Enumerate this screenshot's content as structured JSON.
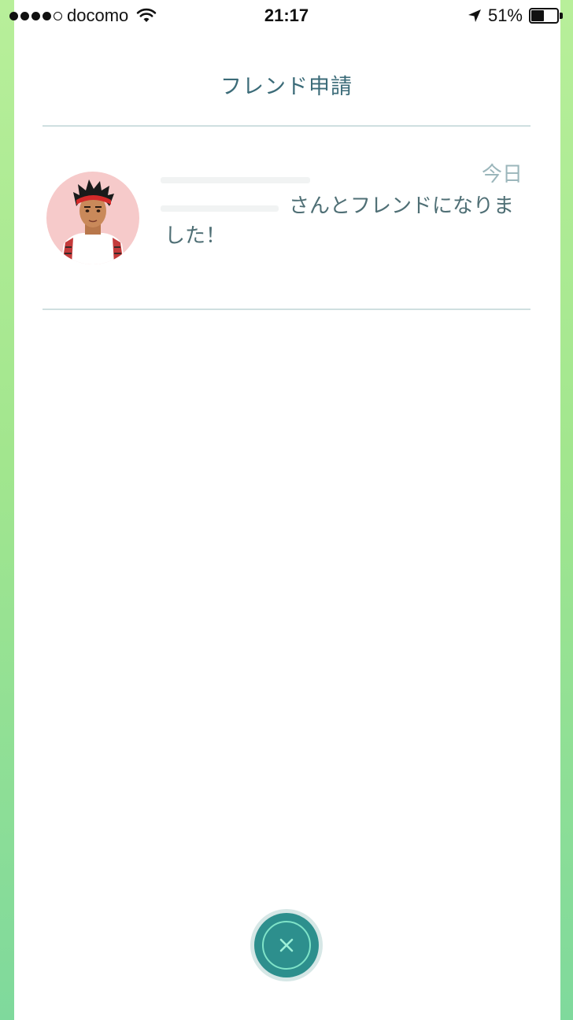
{
  "status_bar": {
    "carrier": "docomo",
    "time": "21:17",
    "battery_percent": "51%",
    "battery_level": 0.51,
    "signal_bars_filled": 4,
    "signal_bars_total": 5
  },
  "header": {
    "title": "フレンド申請"
  },
  "notification": {
    "timestamp": "今日",
    "message": "さんとフレンドになりました！",
    "avatar_icon": "trainer-avatar"
  },
  "close_button": {
    "icon": "close-icon"
  },
  "colors": {
    "accent": "#2d8f8d",
    "title": "#3b6b78",
    "text": "#4f6f75",
    "timestamp": "#9bb6bb",
    "edge_green": "#a2e68e"
  }
}
